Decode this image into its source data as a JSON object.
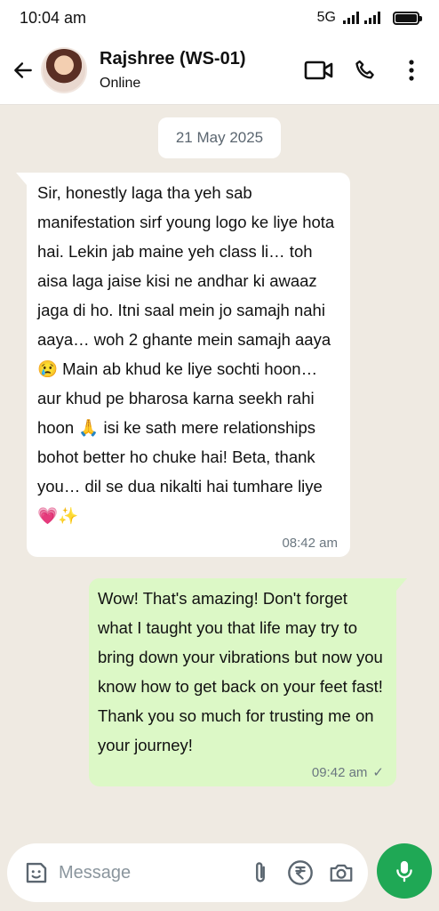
{
  "status_bar": {
    "time": "10:04 am",
    "network": "5G"
  },
  "header": {
    "contact_name": "Rajshree (WS-01)",
    "contact_status": "Online"
  },
  "chat": {
    "date": "21 May 2025",
    "messages": [
      {
        "direction": "incoming",
        "text": "Sir, honestly laga tha yeh sab manifestation sirf young logo ke liye hota hai. Lekin jab maine yeh class li… toh aisa laga jaise kisi ne andhar ki awaaz jaga di ho. Itni saal mein jo samajh nahi aaya… woh 2 ghante mein samajh aaya 😢 Main ab khud ke liye sochti hoon… aur khud pe bharosa karna seekh rahi hoon 🙏 isi ke sath mere relationships bohot better ho chuke hai! Beta, thank you… dil se dua nikalti hai tumhare liye 💗✨",
        "time": "08:42 am"
      },
      {
        "direction": "outgoing",
        "text": "Wow! That's amazing! Don't forget what I taught you that life may try to bring down your vibrations but now you know how to get back on your feet fast! Thank you so much for trusting me on your journey!",
        "time": "09:42 am",
        "status": "✓"
      }
    ]
  },
  "composer": {
    "placeholder": "Message"
  },
  "colors": {
    "chat_background": "#efeae2",
    "outgoing_bubble": "#dcf8c6",
    "incoming_bubble": "#ffffff",
    "mic_button": "#1fa855"
  },
  "icons": [
    "back-arrow-icon",
    "video-call-icon",
    "phone-icon",
    "more-options-icon",
    "sticker-icon",
    "attach-icon",
    "rupee-payment-icon",
    "camera-icon",
    "mic-icon"
  ]
}
